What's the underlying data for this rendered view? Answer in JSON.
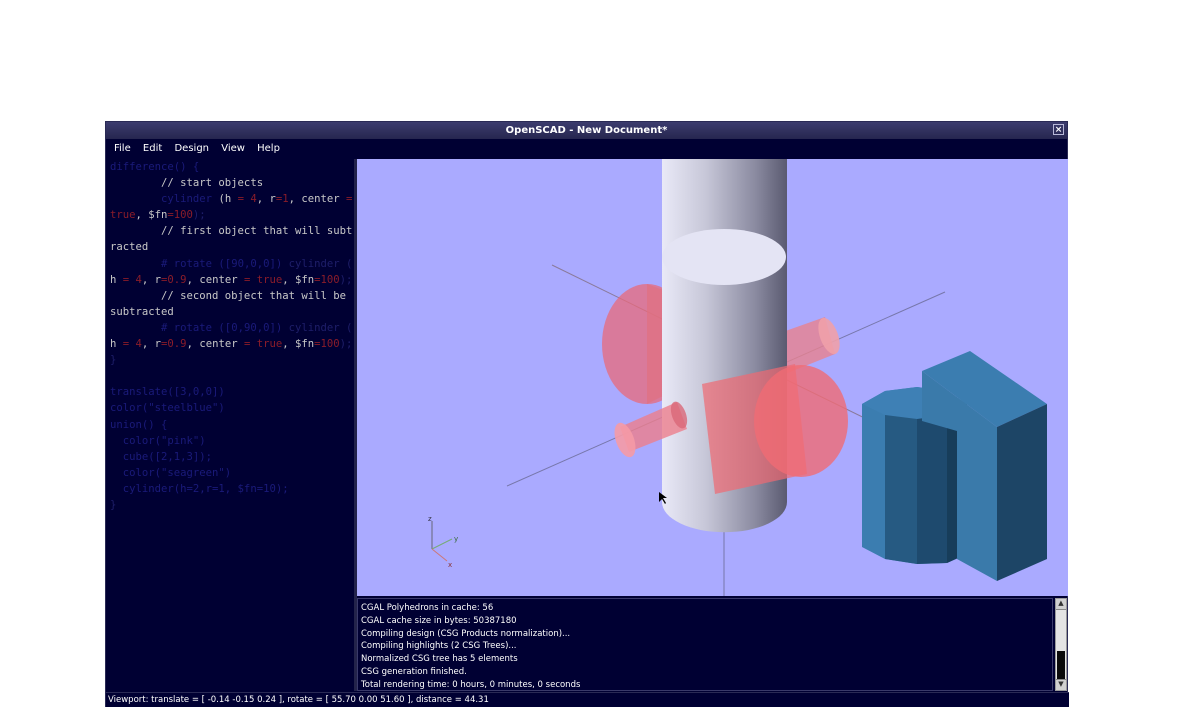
{
  "window": {
    "title": "OpenSCAD - New Document*",
    "close_glyph": "×"
  },
  "menu": [
    "File",
    "Edit",
    "Design",
    "View",
    "Help"
  ],
  "editor": {
    "lines": [
      [
        [
          "difference() {",
          "kw"
        ]
      ],
      [
        [
          "        // start objects",
          "cmt"
        ]
      ],
      [
        [
          "        ",
          "dim"
        ],
        [
          "cylinder",
          "kw"
        ],
        [
          " (h ",
          "cmt"
        ],
        [
          "= 4",
          "num"
        ],
        [
          ", r",
          "cmt"
        ],
        [
          "=1",
          "num"
        ],
        [
          ", center ",
          "cmt"
        ],
        [
          "=",
          "num"
        ]
      ],
      [
        [
          "true",
          "num"
        ],
        [
          ", $fn",
          "cmt"
        ],
        [
          "=100",
          "num"
        ],
        [
          ");",
          "dim"
        ]
      ],
      [
        [
          "        // first object that will subt",
          "cmt"
        ]
      ],
      [
        [
          "racted",
          "cmt"
        ]
      ],
      [
        [
          "        ",
          "dim"
        ],
        [
          "# rotate ([90,0,0]) ",
          "kw"
        ],
        [
          "cylinder (",
          "dim"
        ]
      ],
      [
        [
          "h ",
          "cmt"
        ],
        [
          "= 4",
          "num"
        ],
        [
          ", r",
          "cmt"
        ],
        [
          "=0.9",
          "num"
        ],
        [
          ", center ",
          "cmt"
        ],
        [
          "= true",
          "num"
        ],
        [
          ", $fn",
          "cmt"
        ],
        [
          "=100",
          "num"
        ],
        [
          ");",
          "dim"
        ]
      ],
      [
        [
          "        // second object that will be",
          "cmt"
        ]
      ],
      [
        [
          "subtracted",
          "cmt"
        ]
      ],
      [
        [
          "        ",
          "dim"
        ],
        [
          "# rotate ([0,90,0]) ",
          "kw"
        ],
        [
          "cylinder (",
          "dim"
        ]
      ],
      [
        [
          "h ",
          "cmt"
        ],
        [
          "= 4",
          "num"
        ],
        [
          ", r",
          "cmt"
        ],
        [
          "=0.9",
          "num"
        ],
        [
          ", center ",
          "cmt"
        ],
        [
          "= true",
          "num"
        ],
        [
          ", $fn",
          "cmt"
        ],
        [
          "=100",
          "num"
        ],
        [
          ");",
          "dim"
        ]
      ],
      [
        [
          "}",
          "dim"
        ]
      ],
      [
        [
          "",
          "dim"
        ]
      ],
      [
        [
          "translate([3,0,0])",
          "kw"
        ]
      ],
      [
        [
          "color(\"steelblue\")",
          "kw"
        ]
      ],
      [
        [
          "union() {",
          "kw"
        ]
      ],
      [
        [
          "  color(\"pink\")",
          "kw"
        ]
      ],
      [
        [
          "  cube([2,1,3]);",
          "kw"
        ]
      ],
      [
        [
          "  color(\"seagreen\")",
          "kw"
        ]
      ],
      [
        [
          "  cylinder(h=2,r=1, $fn=10);",
          "kw"
        ]
      ],
      [
        [
          "}",
          "dim"
        ]
      ]
    ]
  },
  "axes_gizmo": {
    "z": "z",
    "y": "y",
    "x": "x"
  },
  "console": {
    "lines": [
      "CGAL Polyhedrons in cache: 56",
      "CGAL cache size in bytes: 50387180",
      "Compiling design (CSG Products normalization)...",
      "Compiling highlights (2 CSG Trees)...",
      "Normalized CSG tree has 5 elements",
      "CSG generation finished.",
      "Total rendering time: 0 hours, 0 minutes, 0 seconds"
    ]
  },
  "statusbar": {
    "text": "Viewport: translate = [ -0.14 -0.15 0.24 ], rotate = [ 55.70 0.00 51.60 ], distance = 44.31"
  },
  "colors": {
    "background": "#000033",
    "viewport": "#aaaaff",
    "highlight": "#ff6a6a",
    "steelblue": "#3a7aa8"
  }
}
